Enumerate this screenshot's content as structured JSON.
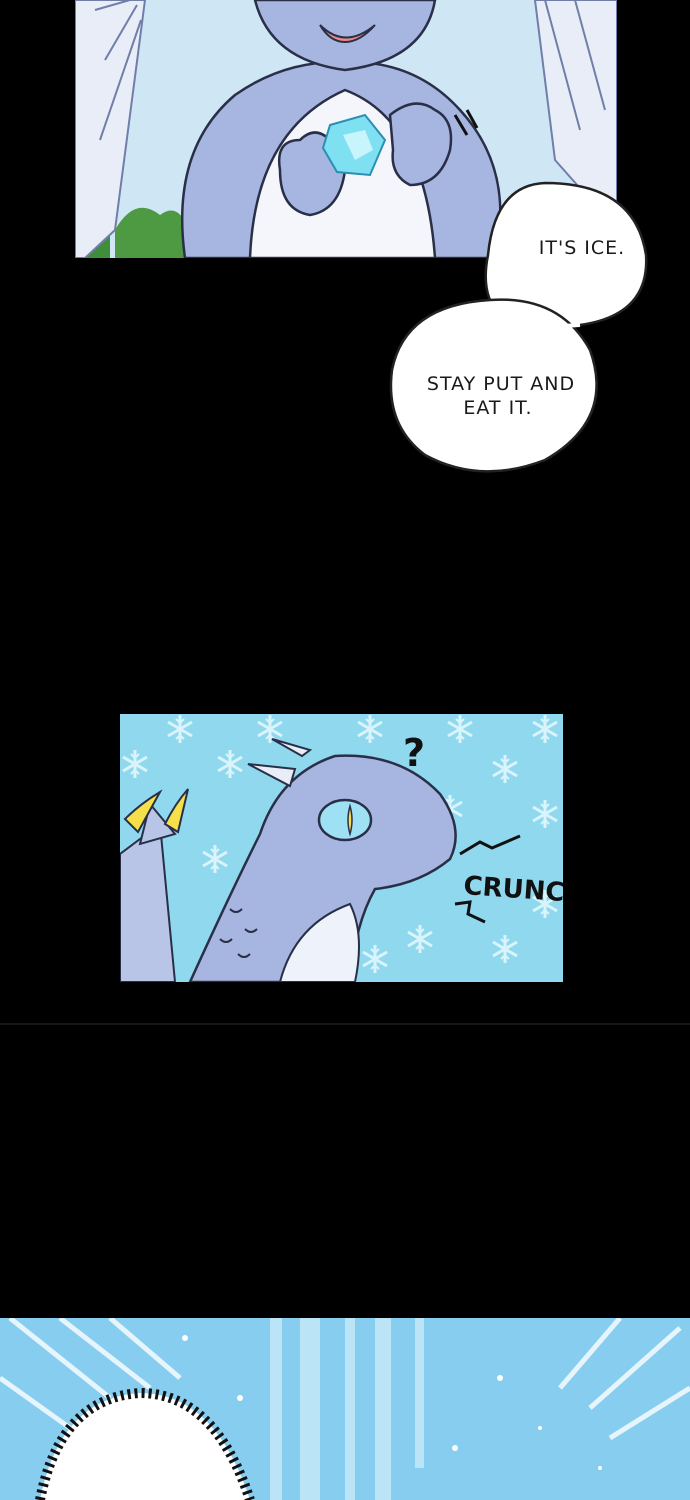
{
  "speech_bubbles": [
    {
      "text_lines": [
        "IT'S ICE."
      ]
    },
    {
      "text_lines": [
        "STAY PUT AND",
        "EAT IT."
      ]
    }
  ],
  "sound_effects": {
    "crunch": "CRUNCH",
    "question_mark": "?"
  },
  "colors": {
    "background": "#000000",
    "dragon_body": "#a7b6e0",
    "ice_crystal": "#7fe0f2",
    "snowflake_bg": "#8fd8ee",
    "eye_yellow": "#f5e04a"
  },
  "icons": [
    "speech-bubble",
    "snowflake-pattern",
    "ice-crystal",
    "dragon",
    "radial-burst"
  ]
}
